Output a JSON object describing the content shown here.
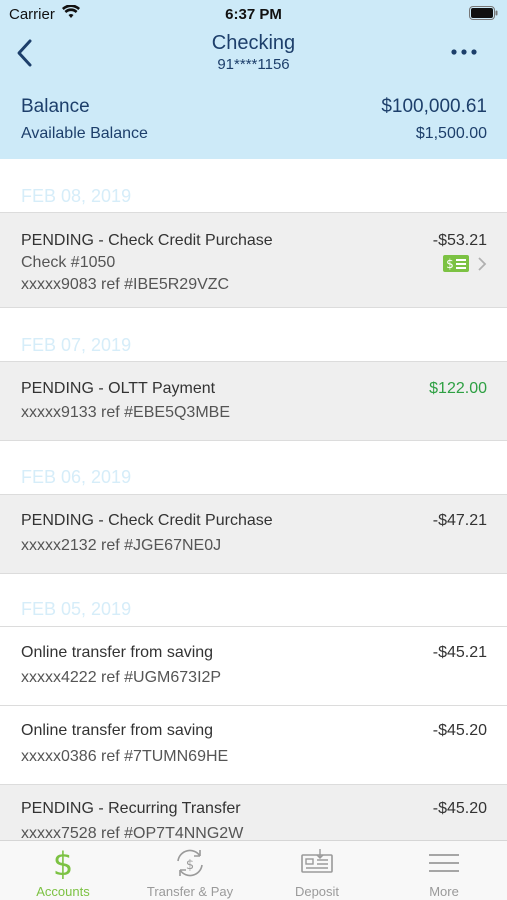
{
  "status": {
    "carrier": "Carrier",
    "time": "6:37 PM"
  },
  "nav": {
    "title": "Checking",
    "account_masked": "91****1156"
  },
  "balance": {
    "label": "Balance",
    "value": "$100,000.61",
    "available_label": "Available Balance",
    "available_value": "$1,500.00"
  },
  "dates": [
    "FEB 08, 2019",
    "FEB 07, 2019",
    "FEB 06, 2019",
    "FEB 05, 2019"
  ],
  "transactions": [
    {
      "title": "PENDING - Check Credit Purchase",
      "check": "Check #1050",
      "ref": "xxxxx9083 ref #IBE5R29VZC",
      "amount": "-$53.21",
      "icon": "check-image-icon"
    },
    {
      "title": "PENDING - OLTT Payment",
      "ref": "xxxxx9133 ref #EBE5Q3MBE",
      "amount": "$122.00"
    },
    {
      "title": "PENDING - Check Credit Purchase",
      "ref": "xxxxx2132 ref #JGE67NE0J",
      "amount": "-$47.21"
    },
    {
      "title": "Online transfer from saving",
      "ref": "xxxxx4222 ref #UGM673I2P",
      "amount": "-$45.21"
    },
    {
      "title": "Online transfer from saving",
      "ref": "xxxxx0386 ref #7TUMN69HE",
      "amount": "-$45.20"
    },
    {
      "title": "PENDING - Recurring Transfer",
      "ref": "xxxxx7528 ref #OP7T4NNG2W",
      "amount": "-$45.20"
    }
  ],
  "tabs": [
    {
      "label": "Accounts",
      "icon": "dollar-icon",
      "active": true
    },
    {
      "label": "Transfer & Pay",
      "icon": "transfer-pay-icon"
    },
    {
      "label": "Deposit",
      "icon": "deposit-check-icon"
    },
    {
      "label": "More",
      "icon": "menu-icon"
    }
  ],
  "colors": {
    "header_bg": "#cdeaf8",
    "accent_green": "#7cc243",
    "credit_green": "#2ea043",
    "navy": "#1d3f6b"
  }
}
